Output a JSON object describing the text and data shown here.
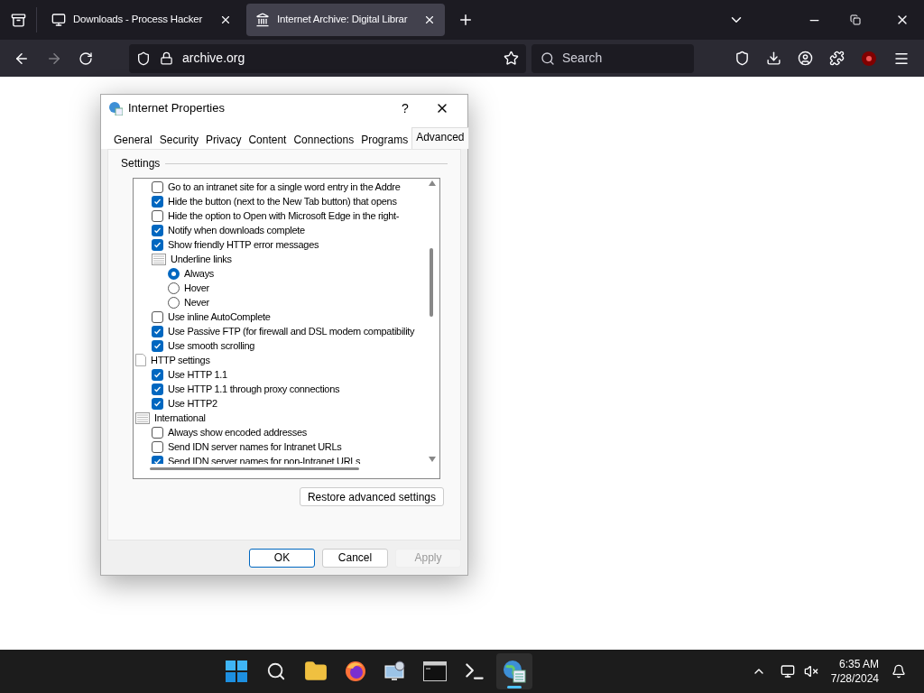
{
  "browser": {
    "tabs": [
      {
        "title": "Downloads - Process Hacker",
        "selected": false
      },
      {
        "title": "Internet Archive: Digital Librar",
        "selected": true
      }
    ],
    "forward_disabled": true,
    "address": "archive.org",
    "search": {
      "placeholder": "Search"
    }
  },
  "dialog": {
    "title": "Internet Properties",
    "help": "?",
    "tabs": [
      {
        "label": "General",
        "selected": false
      },
      {
        "label": "Security",
        "selected": false
      },
      {
        "label": "Privacy",
        "selected": false
      },
      {
        "label": "Content",
        "selected": false
      },
      {
        "label": "Connections",
        "selected": false
      },
      {
        "label": "Programs",
        "selected": false
      },
      {
        "label": "Advanced",
        "selected": true
      }
    ],
    "settings_label": "Settings",
    "continued_items": [
      {
        "kind": "checkbox",
        "label": "Go to an intranet site for a single word entry in the Addre",
        "checked": false
      },
      {
        "kind": "checkbox",
        "label": "Hide the button (next to the New Tab button) that opens",
        "checked": true
      },
      {
        "kind": "checkbox",
        "label": "Hide the option to Open with Microsoft Edge in the right-",
        "checked": false
      },
      {
        "kind": "checkbox",
        "label": "Notify when downloads complete",
        "checked": true
      },
      {
        "kind": "checkbox",
        "label": "Show friendly HTTP error messages",
        "checked": true
      },
      {
        "kind": "group",
        "label": "Underline links",
        "children": [
          {
            "kind": "radio",
            "label": "Always",
            "selected": true
          },
          {
            "kind": "radio",
            "label": "Hover",
            "selected": false
          },
          {
            "kind": "radio",
            "label": "Never",
            "selected": false
          }
        ]
      },
      {
        "kind": "checkbox",
        "label": "Use inline AutoComplete",
        "checked": false
      },
      {
        "kind": "checkbox",
        "label": "Use Passive FTP (for firewall and DSL modem compatibility",
        "checked": true
      },
      {
        "kind": "checkbox",
        "label": "Use smooth scrolling",
        "checked": true
      }
    ],
    "groups": [
      {
        "kind": "section",
        "label": "HTTP settings",
        "children": [
          {
            "kind": "checkbox",
            "label": "Use HTTP 1.1",
            "checked": true
          },
          {
            "kind": "checkbox",
            "label": "Use HTTP 1.1 through proxy connections",
            "checked": true
          },
          {
            "kind": "checkbox",
            "label": "Use HTTP2",
            "checked": true
          }
        ]
      },
      {
        "kind": "group",
        "label": "International",
        "children": [
          {
            "kind": "checkbox",
            "label": "Always show encoded addresses",
            "checked": false
          },
          {
            "kind": "checkbox",
            "label": "Send IDN server names for Intranet URLs",
            "checked": false
          },
          {
            "kind": "checkbox",
            "label": "Send IDN server names for non-Intranet URLs",
            "checked": true
          }
        ]
      }
    ],
    "restore_button": "Restore advanced settings",
    "buttons": [
      {
        "label": "OK",
        "kind": "default",
        "disabled": false
      },
      {
        "label": "Cancel",
        "kind": "normal",
        "disabled": false
      },
      {
        "label": "Apply",
        "kind": "normal",
        "disabled": true
      }
    ]
  },
  "taskbar": {
    "apps": [
      {
        "kind": "start",
        "selected": false
      },
      {
        "kind": "search",
        "selected": false
      },
      {
        "kind": "folder",
        "selected": false
      },
      {
        "kind": "firefox",
        "selected": false
      },
      {
        "kind": "network",
        "selected": false
      },
      {
        "kind": "console",
        "selected": false
      },
      {
        "kind": "terminal",
        "selected": false
      },
      {
        "kind": "globe",
        "selected": true
      }
    ],
    "time": "6:35 AM",
    "date": "7/28/2024"
  }
}
